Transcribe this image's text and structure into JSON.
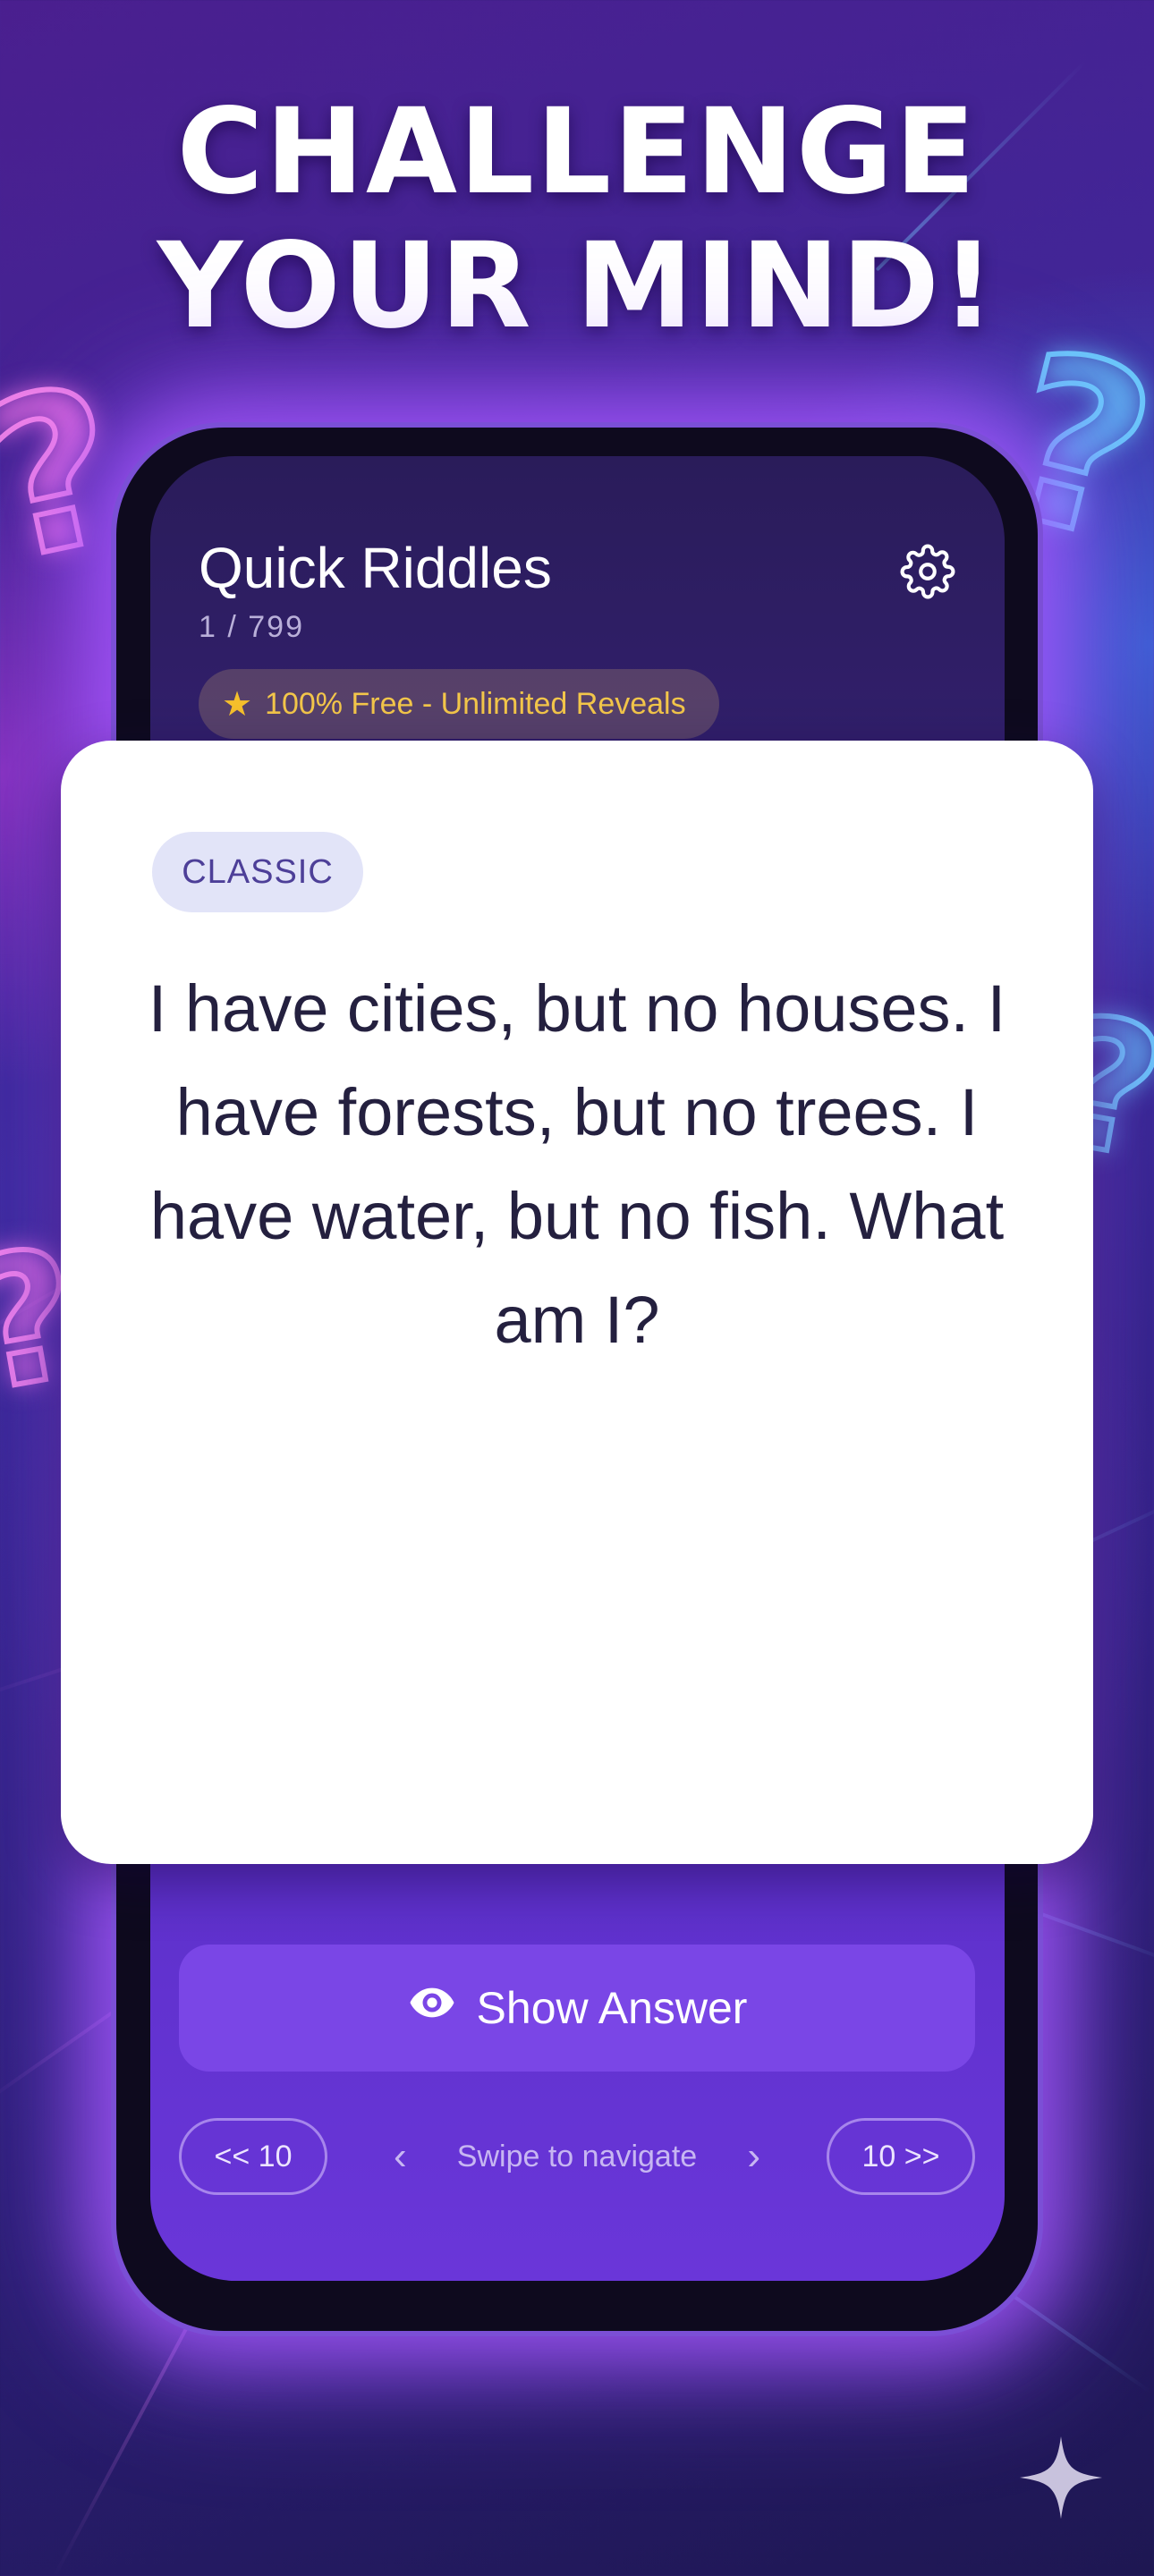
{
  "headline": {
    "line1": "CHALLENGE",
    "line2": "YOUR MIND!"
  },
  "app": {
    "title": "Quick Riddles",
    "counter": "1 / 799",
    "free_badge": "100% Free - Unlimited Reveals"
  },
  "card": {
    "category": "CLASSIC",
    "riddle": "I have cities, but no houses. I have forests, but no trees. I have water, but no fish. What am I?"
  },
  "controls": {
    "show_answer": "Show Answer",
    "back_10": "<< 10",
    "forward_10": "10 >>",
    "swipe_hint": "Swipe to navigate",
    "chevron_left": "‹",
    "chevron_right": "›"
  },
  "icons": {
    "settings": "gear-icon",
    "star": "star-icon",
    "show_answer": "eye-icon",
    "watermark": "sparkle-icon"
  },
  "colors": {
    "accent": "#7a46e6",
    "badge_text": "#f3c64a",
    "card_bg": "#ffffff",
    "riddle_text": "#24203f"
  }
}
